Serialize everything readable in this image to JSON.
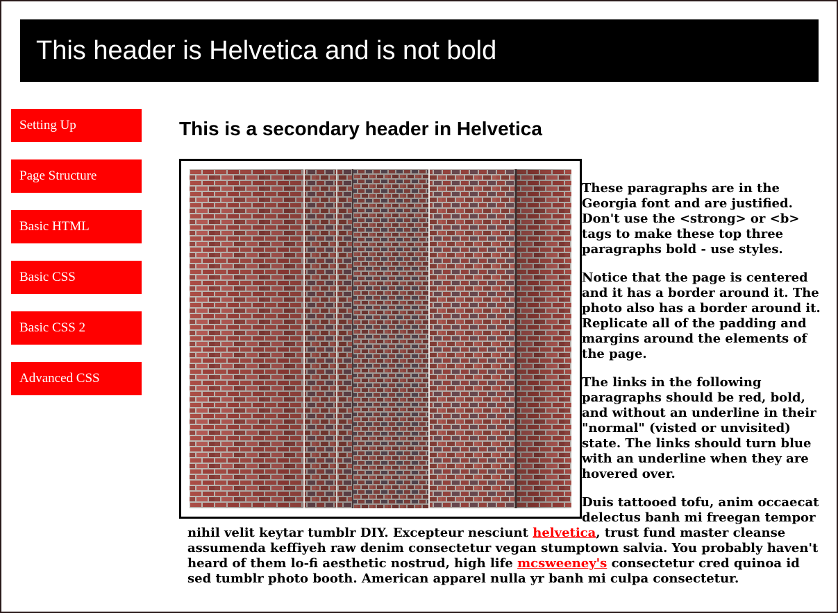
{
  "header": {
    "title": "This header is Helvetica and is not bold"
  },
  "nav": {
    "items": [
      {
        "label": "Setting Up"
      },
      {
        "label": "Page Structure"
      },
      {
        "label": "Basic HTML"
      },
      {
        "label": "Basic CSS"
      },
      {
        "label": "Basic CSS 2"
      },
      {
        "label": "Advanced CSS"
      }
    ]
  },
  "main": {
    "heading": "This is a secondary header in Helvetica",
    "paragraphs": [
      "These paragraphs are in the Georgia font and are justified. Don't use the <strong> or <b> tags to make these top three paragraphs bold - use styles.",
      "Notice that the page is centered and it has a border around it. The photo also has a border around it. Replicate all of the padding and margins around the elements of the page.",
      "The links in the following paragraphs should be red, bold, and without an underline in their \"normal\" (visted or unvisited) state. The links should turn blue with an underline when they are hovered over."
    ],
    "lorem": {
      "part1": "Duis tattooed tofu, anim occaecat delectus banh mi freegan tempor nihil velit keytar tumblr DIY. Excepteur nesciunt ",
      "link1": "helvetica",
      "part2": ", trust fund master cleanse assumenda keffiyeh raw denim consectetur vegan stumptown salvia. You probably haven't heard of them lo-fi aesthetic nostrud, high life ",
      "link2": "mcsweeney's",
      "part3": " consectetur cred quinoa id sed tumblr photo booth. American apparel nulla yr banh mi culpa consectetur."
    }
  },
  "colors": {
    "nav_bg": "#ff0000",
    "header_bg": "#000000",
    "link": "#ff0000"
  },
  "icons": {
    "photo": "brick-wall-photo"
  }
}
